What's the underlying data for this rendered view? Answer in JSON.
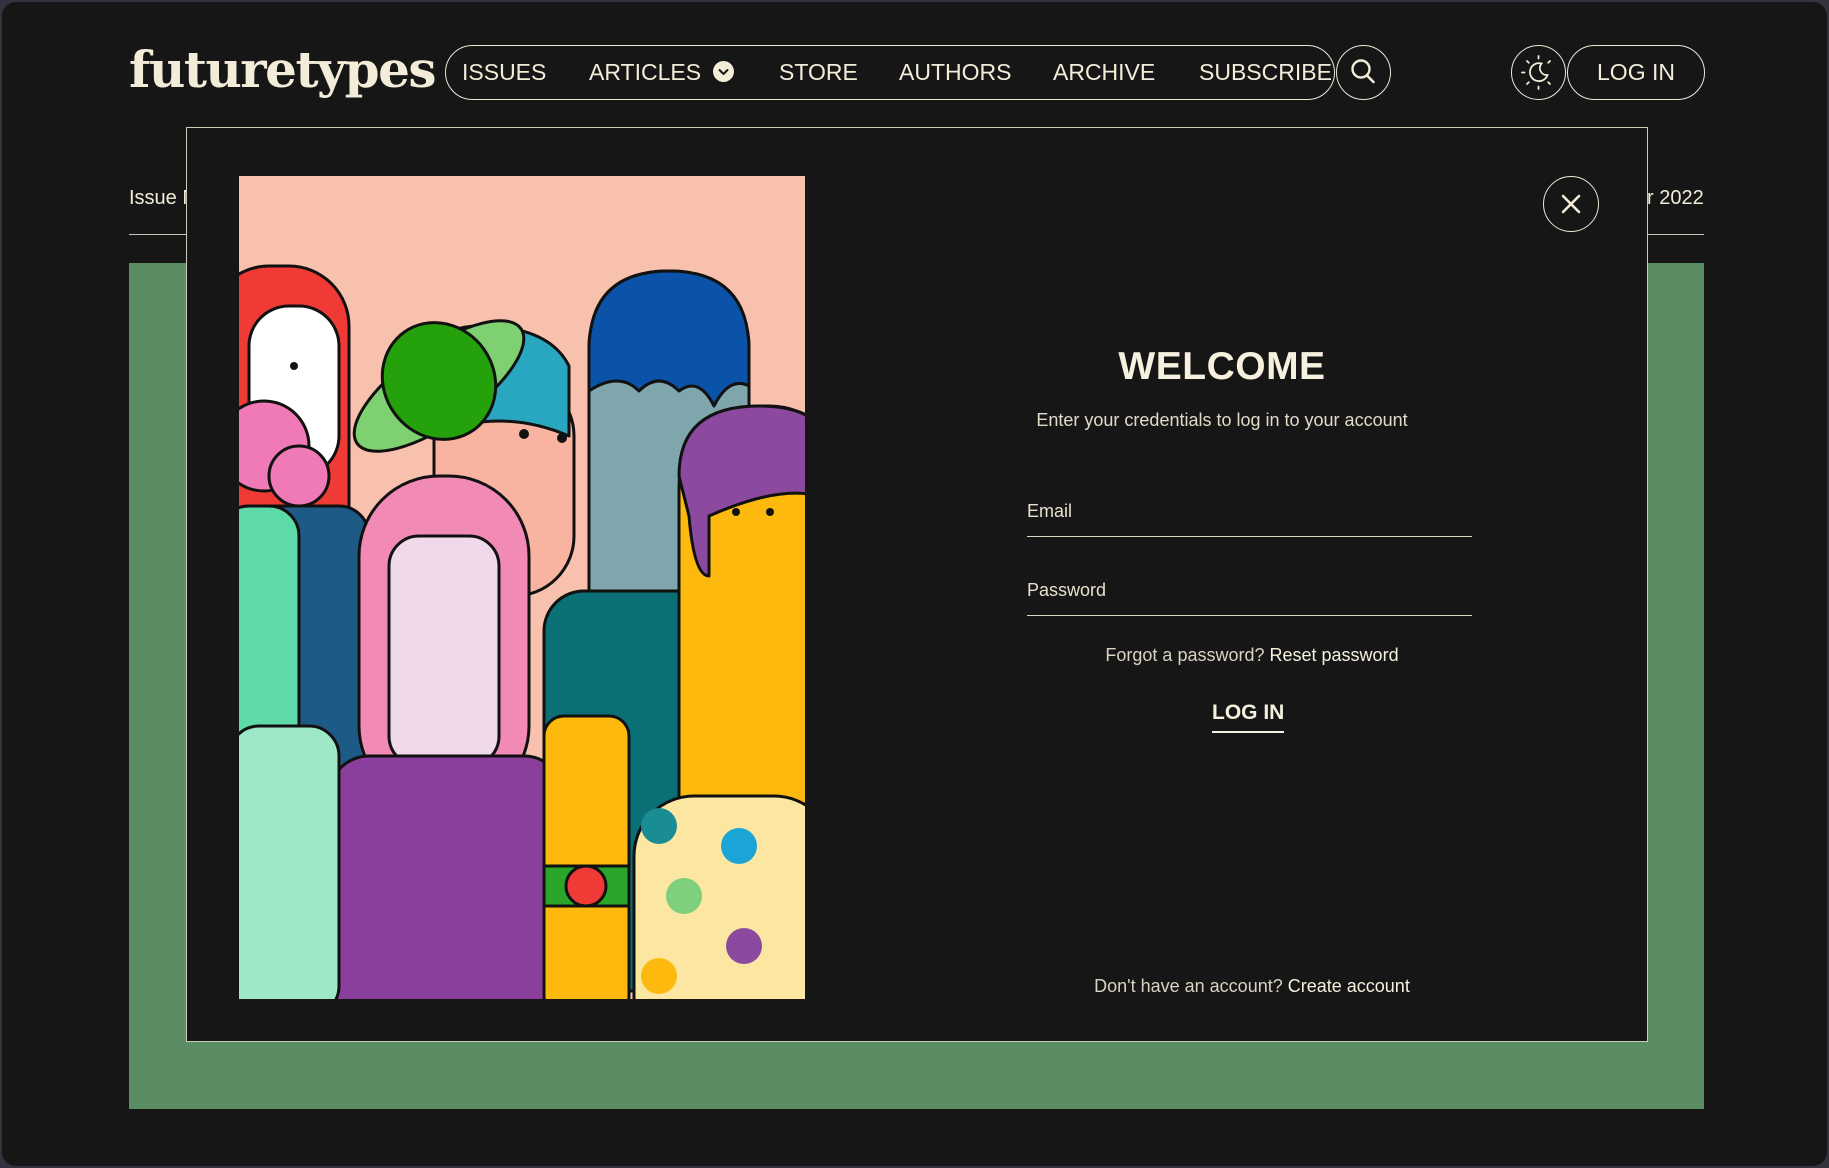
{
  "header": {
    "logo": "futuretypes",
    "nav": {
      "issues": "ISSUES",
      "articles": "ARTICLES",
      "store": "STORE",
      "authors": "AUTHORS",
      "archive": "ARCHIVE",
      "subscribe": "SUBSCRIBE"
    },
    "login_label": "LOG IN"
  },
  "background": {
    "issue_prefix": "Issue N",
    "date_suffix": "r 2022",
    "panel_color": "#5a8d63"
  },
  "modal": {
    "title": "WELCOME",
    "subtitle": "Enter your credentials to log in to your account",
    "email_placeholder": "Email",
    "password_placeholder": "Password",
    "forgot_text": "Forgot a password?",
    "reset_link": "Reset password",
    "login_button": "LOG IN",
    "signup_text": "Don't have an account?",
    "signup_link": "Create account"
  },
  "icons": {
    "search": "search-icon",
    "theme": "sun-moon-icon",
    "close": "close-icon",
    "dropdown": "chevron-down-icon"
  }
}
